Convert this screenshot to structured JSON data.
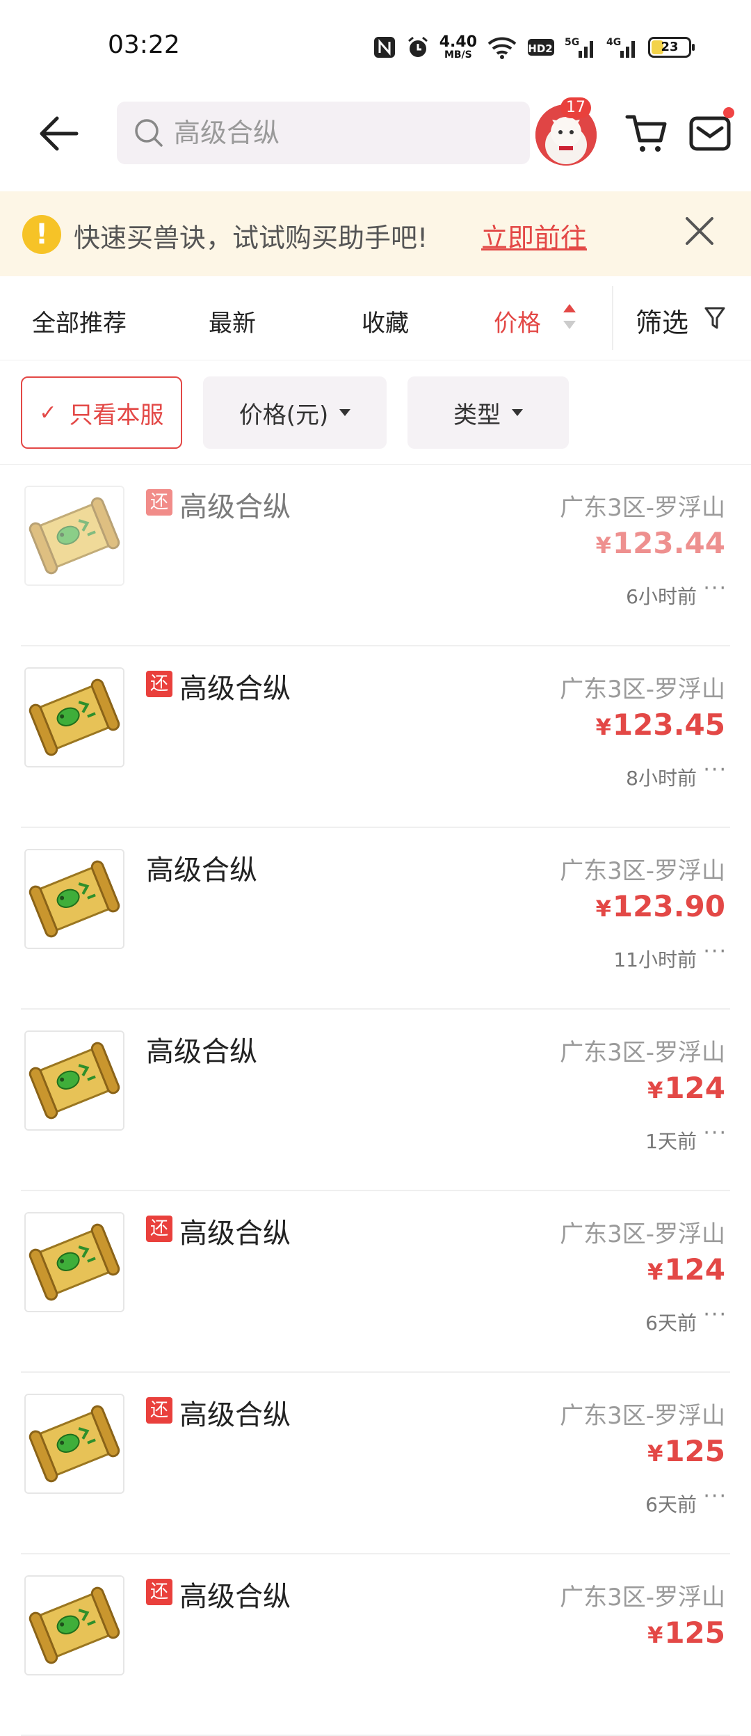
{
  "status_bar": {
    "time": "03:22",
    "net_speed_value": "4.40",
    "net_speed_unit": "MB/S",
    "hd_label": "HD2",
    "sim1_label": "5G",
    "sim2_label": "4G",
    "battery_level": "23"
  },
  "header": {
    "search_placeholder": "高级合纵",
    "avatar_badge": "17"
  },
  "banner": {
    "text": "快速买兽诀，试试购买助手吧!",
    "link": "立即前往"
  },
  "sort_tabs": {
    "recommend": "全部推荐",
    "latest": "最新",
    "favorite": "收藏",
    "price": "价格",
    "filter": "筛选"
  },
  "chips": {
    "this_server": "只看本服",
    "price": "价格(元)",
    "type": "类型"
  },
  "items": [
    {
      "tag": "还",
      "title": "高级合纵",
      "server": "广东3区-罗浮山",
      "currency": "¥",
      "price": "123.44",
      "time_ago": "6小时前",
      "more": "···"
    },
    {
      "tag": "还",
      "title": "高级合纵",
      "server": "广东3区-罗浮山",
      "currency": "¥",
      "price": "123.45",
      "time_ago": "8小时前",
      "more": "···"
    },
    {
      "tag": "",
      "title": "高级合纵",
      "server": "广东3区-罗浮山",
      "currency": "¥",
      "price": "123.90",
      "time_ago": "11小时前",
      "more": "···"
    },
    {
      "tag": "",
      "title": "高级合纵",
      "server": "广东3区-罗浮山",
      "currency": "¥",
      "price": "124",
      "time_ago": "1天前",
      "more": "···"
    },
    {
      "tag": "还",
      "title": "高级合纵",
      "server": "广东3区-罗浮山",
      "currency": "¥",
      "price": "124",
      "time_ago": "6天前",
      "more": "···"
    },
    {
      "tag": "还",
      "title": "高级合纵",
      "server": "广东3区-罗浮山",
      "currency": "¥",
      "price": "125",
      "time_ago": "6天前",
      "more": "···"
    },
    {
      "tag": "还",
      "title": "高级合纵",
      "server": "广东3区-罗浮山",
      "currency": "¥",
      "price": "125",
      "time_ago": "",
      "more": ""
    }
  ],
  "colors": {
    "accent": "#e34846",
    "banner_bg": "#fdf6e6",
    "warning": "#f6c327"
  }
}
